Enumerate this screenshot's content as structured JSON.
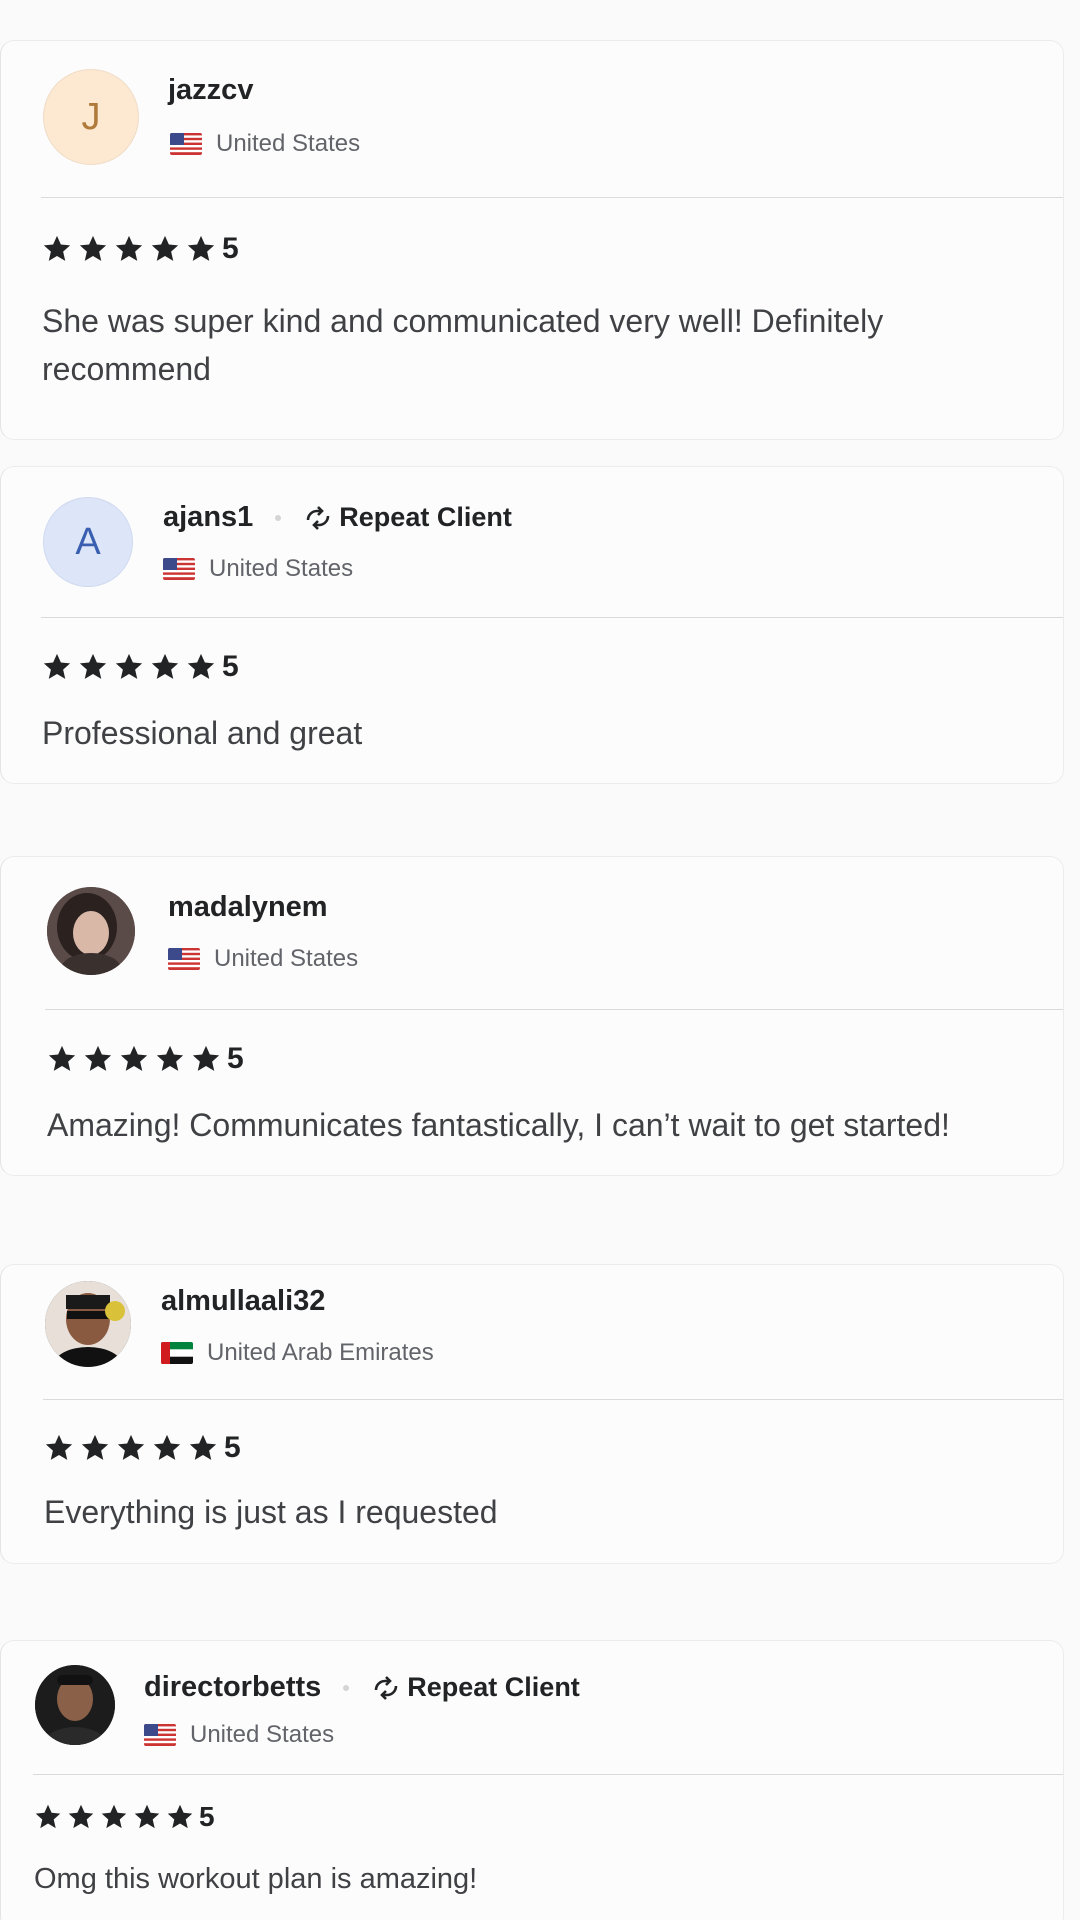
{
  "reviews": [
    {
      "avatar_letter": "J",
      "username": "jazzcv",
      "repeat_client": false,
      "country": "United States",
      "flag": "us-flag",
      "rating": "5",
      "text": "She was super kind and communicated very well! Definitely recommend"
    },
    {
      "avatar_letter": "A",
      "username": "ajans1",
      "repeat_client": true,
      "repeat_label": "Repeat Client",
      "country": "United States",
      "flag": "us-flag",
      "rating": "5",
      "text": "Professional and great"
    },
    {
      "avatar_letter": "",
      "username": "madalynem",
      "repeat_client": false,
      "country": "United States",
      "flag": "us-flag",
      "rating": "5",
      "text": "Amazing! Communicates fantastically, I can’t wait to get started!"
    },
    {
      "avatar_letter": "",
      "username": "almullaali32",
      "repeat_client": false,
      "country": "United Arab Emirates",
      "flag": "uae-flag",
      "rating": "5",
      "text": "Everything is just as I requested"
    },
    {
      "avatar_letter": "",
      "username": "directorbetts",
      "repeat_client": true,
      "repeat_label": "Repeat Client",
      "country": "United States",
      "flag": "us-flag",
      "rating": "5",
      "text": "Omg this workout plan is amazing!"
    }
  ],
  "colors": {
    "star": "#222325",
    "text": "#404145",
    "muted": "#62646a",
    "divider": "#dadbdd"
  }
}
